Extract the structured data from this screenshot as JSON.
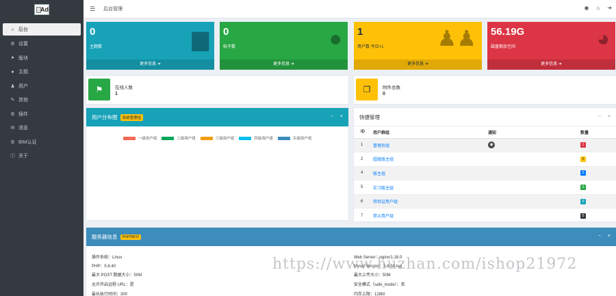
{
  "sidebar": {
    "logo": "Ad",
    "items": [
      {
        "label": "后台",
        "icon": "home-icon",
        "glyph": "⌂",
        "active": true
      },
      {
        "label": "设置",
        "icon": "gear-icon",
        "glyph": "⚙"
      },
      {
        "label": "版块",
        "icon": "comments-icon",
        "glyph": "●"
      },
      {
        "label": "主题",
        "icon": "comment-icon",
        "glyph": "●"
      },
      {
        "label": "用户",
        "icon": "user-icon",
        "glyph": "♟"
      },
      {
        "label": "其他",
        "icon": "wrench-icon",
        "glyph": "✎"
      },
      {
        "label": "插件",
        "icon": "cogs-icon",
        "glyph": "⚙"
      },
      {
        "label": "消息",
        "icon": "bullhorn-icon",
        "glyph": "✉"
      },
      {
        "label": "BIM认证",
        "icon": "users-cog-icon",
        "glyph": "⚙"
      },
      {
        "label": "关于",
        "icon": "info-icon",
        "glyph": "ⓘ"
      }
    ]
  },
  "topbar": {
    "breadcrumb": "后台管理",
    "icons": [
      "github-icon",
      "home-icon",
      "logout-icon"
    ]
  },
  "stats": [
    {
      "value": "0",
      "label": "主题数",
      "more": "更多信息 ➜",
      "color": "#17a2b8",
      "icon": "comment-icon",
      "glyph": "▆"
    },
    {
      "value": "0",
      "label": "帖子数",
      "more": "更多信息 ➜",
      "color": "#28a745",
      "icon": "comments-icon",
      "glyph": "●"
    },
    {
      "value": "1",
      "label": "用户数 今日+1",
      "more": "更多信息 ➜",
      "color": "#ffc107",
      "icon": "users-icon",
      "glyph": "♟♟"
    },
    {
      "value": "56.19G",
      "label": "磁盘剩余空间",
      "more": "更多信息 ➜",
      "color": "#dc3545",
      "icon": "pie-chart-icon",
      "glyph": "◕"
    }
  ],
  "info_boxes": [
    {
      "title": "在线人数",
      "value": "1",
      "color": "#28a745",
      "icon": "flag-icon",
      "glyph": "⚑"
    },
    {
      "title": "附件总数",
      "value": "0",
      "color": "#ffc107",
      "icon": "copy-icon",
      "glyph": "❐"
    }
  ],
  "user_distribution": {
    "title": "用户分布图",
    "badge": "系统管理组",
    "tools": [
      "−",
      "×"
    ],
    "legend": [
      {
        "name": "一级用户组",
        "color": "#f56954"
      },
      {
        "name": "二级用户组",
        "color": "#00a65a"
      },
      {
        "name": "三级用户组",
        "color": "#f39c12"
      },
      {
        "name": "四级用户组",
        "color": "#00c0ef"
      },
      {
        "name": "五级用户组",
        "color": "#3c8dbc"
      }
    ]
  },
  "quick_manage": {
    "title": "快捷管理",
    "tools": [
      "−",
      "×"
    ],
    "headers": [
      "ID",
      "用户群组",
      "通知",
      "数量"
    ],
    "rows": [
      {
        "id": "1",
        "name": "管理员组",
        "notice": "github-icon",
        "count": "1",
        "color": "#dc3545"
      },
      {
        "id": "2",
        "name": "超级版主组",
        "notice": "",
        "count": "0",
        "color": "#ffc107"
      },
      {
        "id": "4",
        "name": "版主组",
        "notice": "",
        "count": "0",
        "color": "#007bff"
      },
      {
        "id": "5",
        "name": "实习版主组",
        "notice": "",
        "count": "0",
        "color": "#28a745"
      },
      {
        "id": "6",
        "name": "待验证用户组",
        "notice": "",
        "count": "0",
        "color": "#17a2b8"
      },
      {
        "id": "7",
        "name": "禁止用户组",
        "notice": "",
        "count": "0",
        "color": "#343a40"
      }
    ]
  },
  "server_info": {
    "title": "服务器信息",
    "badge": "PHPINFO",
    "tools": [
      "−",
      "×"
    ],
    "left": [
      "操作系统：Linux",
      "PHP：5.6.40",
      "最大 POST 数据大小：50M",
      "允许开启远程 URL：是",
      "最长执行时间：300"
    ],
    "right": [
      "Web Server：nginx/1.18.0",
      "Mysql Version：5.6.50-log",
      "最大上传大小：50M",
      "安全模式（safe_mode）：否",
      "内存上限：128M"
    ]
  },
  "watermark": "https://www.huzhan.com/ishop21972"
}
